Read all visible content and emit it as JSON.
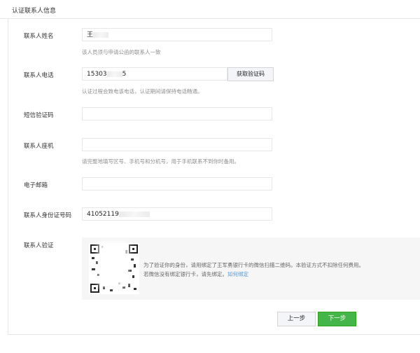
{
  "section_title": "认证联系人信息",
  "fields": {
    "name": {
      "label": "联系人姓名",
      "value_prefix": "王",
      "value_suffix": "",
      "hint": "该人员须与申请公函的联系人一致"
    },
    "phone": {
      "label": "联系人电话",
      "value_prefix": "15303",
      "value_suffix": "5",
      "hint": "认证过程会致电该电话，认证期间请保持电话畅通。",
      "get_code_label": "获取验证码"
    },
    "sms": {
      "label": "短信验证码",
      "value": ""
    },
    "landline": {
      "label": "联系人座机",
      "value": "",
      "hint": "请完整地填写区号、手机号和分机号，用于手机联系不到你时备用。"
    },
    "email": {
      "label": "电子邮箱",
      "value": ""
    },
    "id_number": {
      "label": "联系人身份证号码",
      "value_prefix": "41052119",
      "value_suffix": ""
    },
    "verify": {
      "label": "联系人验证",
      "text_line1": "为了验证你的身份，请用绑定了王军勇银行卡的微信扫描二维码。本验证方式不扣除任何费用。",
      "text_line2": "若微信没有绑定银行卡，请先绑定。",
      "link": "如何绑定"
    }
  },
  "buttons": {
    "prev": "上一步",
    "next": "下一步"
  },
  "colors": {
    "primary_button": "#44b549",
    "link": "#459ae9"
  }
}
